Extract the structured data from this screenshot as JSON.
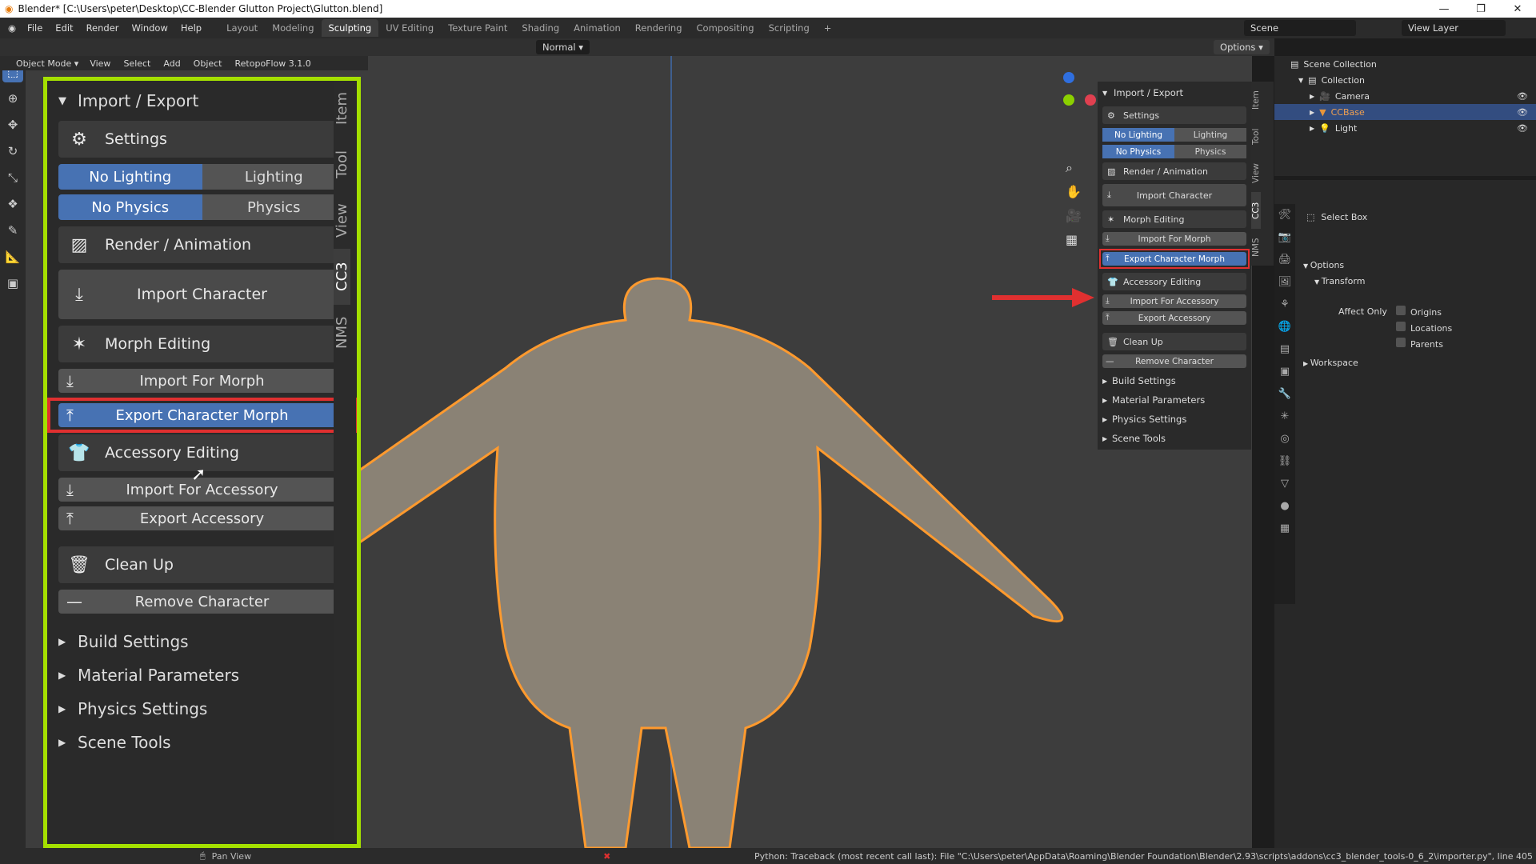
{
  "window": {
    "title": "Blender* [C:\\Users\\peter\\Desktop\\CC-Blender Glutton Project\\Glutton.blend]"
  },
  "menus": [
    "File",
    "Edit",
    "Render",
    "Window",
    "Help"
  ],
  "workspace_tabs": [
    {
      "label": "Layout"
    },
    {
      "label": "Modeling"
    },
    {
      "label": "Sculpting",
      "active": true
    },
    {
      "label": "UV Editing"
    },
    {
      "label": "Texture Paint"
    },
    {
      "label": "Shading"
    },
    {
      "label": "Animation"
    },
    {
      "label": "Rendering"
    },
    {
      "label": "Compositing"
    },
    {
      "label": "Scripting"
    }
  ],
  "scene": "Scene",
  "view_layer": "View Layer",
  "header": {
    "orientation": "Normal",
    "options": "Options",
    "mode": "Object Mode",
    "view": "View",
    "select": "Select",
    "add": "Add",
    "object": "Object",
    "addon": "RetopoFlow 3.1.0"
  },
  "big_panel": {
    "title": "Import / Export",
    "settings": "Settings",
    "lighting": [
      "No Lighting",
      "Lighting"
    ],
    "physics": [
      "No Physics",
      "Physics"
    ],
    "render_animation": "Render / Animation",
    "import_character": "Import Character",
    "morph_editing": "Morph Editing",
    "import_for_morph": "Import For Morph",
    "export_character_morph": "Export Character Morph",
    "accessory_editing": "Accessory Editing",
    "import_for_accessory": "Import For Accessory",
    "export_accessory": "Export Accessory",
    "clean_up": "Clean Up",
    "remove_character": "Remove Character",
    "sections": [
      "Build Settings",
      "Material Parameters",
      "Physics Settings",
      "Scene Tools"
    ],
    "tabs": [
      "Item",
      "Tool",
      "View",
      "CC3",
      "NMS"
    ]
  },
  "outliner": {
    "root": "Scene Collection",
    "collection": "Collection",
    "items": [
      {
        "label": "Camera"
      },
      {
        "label": "CCBase",
        "selected": true
      },
      {
        "label": "Light"
      }
    ]
  },
  "properties": {
    "tool": "Select Box",
    "options": "Options",
    "transform": "Transform",
    "affect_only": "Affect Only",
    "checks": [
      "Origins",
      "Locations",
      "Parents"
    ],
    "workspace": "Workspace"
  },
  "status": {
    "left": "Pan View",
    "error": "Python: Traceback (most recent call last):  File \"C:\\Users\\peter\\AppData\\Roaming\\Blender Foundation\\Blender\\2.93\\scripts\\addons\\cc3_blender_tools-0_6_2\\importer.py\", line 405"
  },
  "colors": {
    "accent": "#4772b3",
    "highlight": "#a4e000",
    "callout": "#e03030"
  }
}
